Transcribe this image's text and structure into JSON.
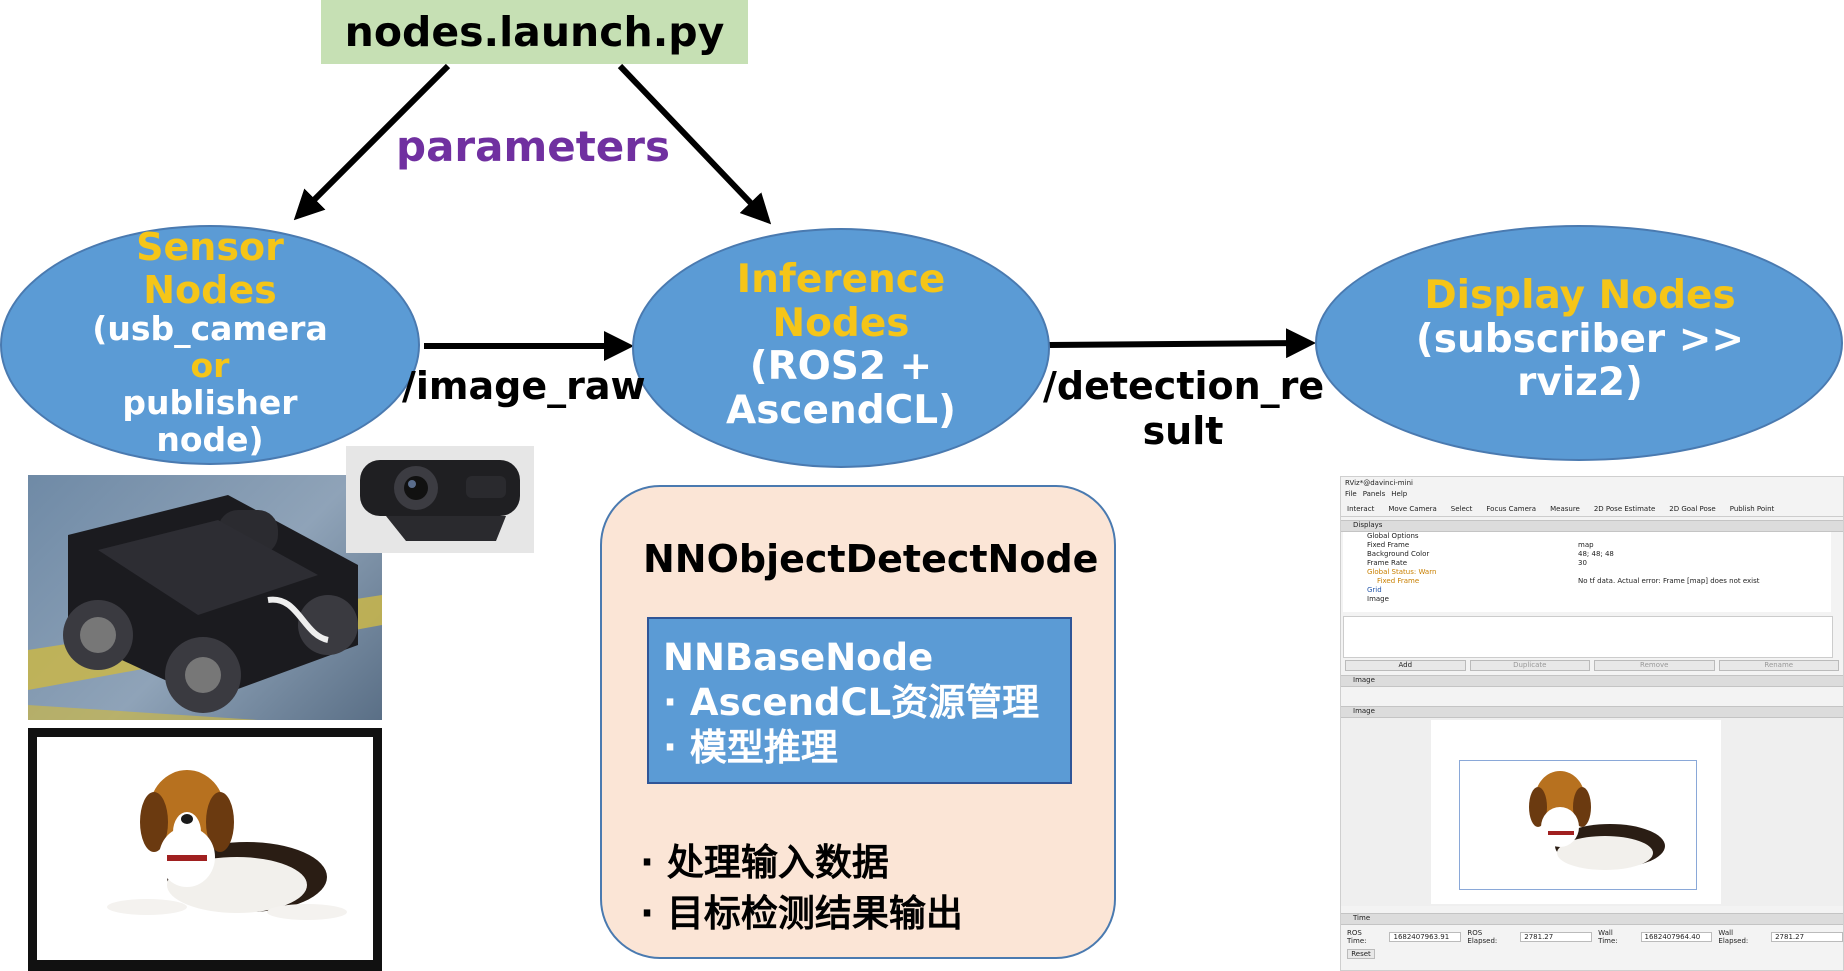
{
  "launch": {
    "file": "nodes.launch.py",
    "params_label": "parameters"
  },
  "sensor": {
    "title1": "Sensor",
    "title2": "Nodes",
    "line1": "(usb_camera",
    "or": "or",
    "line3": "publisher",
    "line4": "node)"
  },
  "inference": {
    "title1": "Inference",
    "title2": "Nodes",
    "line1": "(ROS2 +",
    "line2": "AscendCL)"
  },
  "display": {
    "title": "Display Nodes",
    "line1": "(subscriber >>",
    "line2": "rviz2)"
  },
  "topics": {
    "image_raw": "/image_raw",
    "det1": "/detection_re",
    "det2": "sult"
  },
  "detector": {
    "title": "NNObjectDetectNode",
    "base_title": "NNBaseNode",
    "base_items": [
      "· AscendCL资源管理",
      "· 模型推理"
    ],
    "items": [
      "· 处理输入数据",
      "· 目标检测结果输出"
    ]
  },
  "rviz": {
    "window_title": "RViz*@davinci-mini",
    "menu": [
      "File",
      "Panels",
      "Help"
    ],
    "toolbar": [
      "Interact",
      "Move Camera",
      "Select",
      "Focus Camera",
      "Measure",
      "2D Pose Estimate",
      "2D Goal Pose",
      "Publish Point"
    ],
    "displays_title": "Displays",
    "tree": [
      {
        "name": "Global Options",
        "value": ""
      },
      {
        "name": "Fixed Frame",
        "value": "map"
      },
      {
        "name": "Background Color",
        "value": "48; 48; 48"
      },
      {
        "name": "Frame Rate",
        "value": "30"
      },
      {
        "name": "Global Status: Warn",
        "value": ""
      },
      {
        "name": "Fixed Frame",
        "value": "No tf data.  Actual error: Frame [map] does not exist"
      },
      {
        "name": "Grid",
        "value": ""
      },
      {
        "name": "Image",
        "value": ""
      }
    ],
    "buttons": [
      "Add",
      "Duplicate",
      "Remove",
      "Rename"
    ],
    "image_panel1": "Image",
    "image_panel2": "Image",
    "time_title": "Time",
    "time_fields": [
      {
        "label": "ROS Time:",
        "value": "1682407963.91"
      },
      {
        "label": "ROS Elapsed:",
        "value": "2781.27"
      },
      {
        "label": "Wall Time:",
        "value": "1682407964.40"
      },
      {
        "label": "Wall Elapsed:",
        "value": "2781.27"
      }
    ],
    "reset": "Reset"
  },
  "colors": {
    "ellipse": "#5b9bd5",
    "title_yellow": "#f5c518",
    "launch_bg": "#c6e0b4",
    "params_purple": "#7030a0",
    "detector_bg": "#fbe5d6",
    "base_bg": "#5b9bd5"
  },
  "icons": [
    "robot-car-photo",
    "webcam-photo",
    "dog-photo",
    "rviz-screenshot"
  ]
}
